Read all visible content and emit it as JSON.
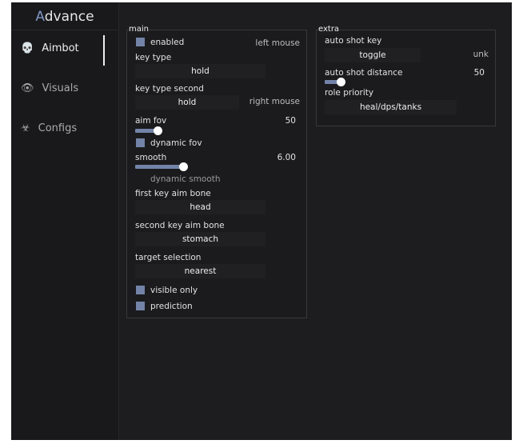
{
  "app": {
    "logo_accent": "A",
    "logo_rest": "dvance",
    "accent": "#7f96c4"
  },
  "sidebar": {
    "items": [
      {
        "label": "Aimbot",
        "icon": "skull-icon",
        "active": true
      },
      {
        "label": "Visuals",
        "icon": "eye-icon"
      },
      {
        "label": "Configs",
        "icon": "biohazard-icon"
      }
    ]
  },
  "main": {
    "title": "main",
    "enabled": {
      "label": "enabled",
      "checked": true,
      "key": "left mouse"
    },
    "key_type": {
      "label": "key type",
      "value": "hold"
    },
    "key_type_second": {
      "label": "key type second",
      "value": "hold",
      "key": "right mouse"
    },
    "aim_fov": {
      "label": "aim fov",
      "value": "50"
    },
    "dynamic_fov": {
      "label": "dynamic fov",
      "checked": true
    },
    "smooth": {
      "label": "smooth",
      "value": "6.00"
    },
    "dynamic_smooth": {
      "label": "dynamic smooth",
      "checked": false
    },
    "first_bone": {
      "label": "first key aim bone",
      "value": "head"
    },
    "second_bone": {
      "label": "second key aim bone",
      "value": "stomach"
    },
    "target": {
      "label": "target selection",
      "value": "nearest"
    },
    "visible_only": {
      "label": "visible only",
      "checked": true
    },
    "prediction": {
      "label": "prediction",
      "checked": true
    }
  },
  "extra": {
    "title": "extra",
    "auto_shot_key": {
      "label": "auto shot key",
      "value": "toggle",
      "key": "unk"
    },
    "auto_shot_distance": {
      "label": "auto shot distance",
      "value": "50"
    },
    "role_priority": {
      "label": "role priority",
      "value": "heal/dps/tanks"
    }
  }
}
